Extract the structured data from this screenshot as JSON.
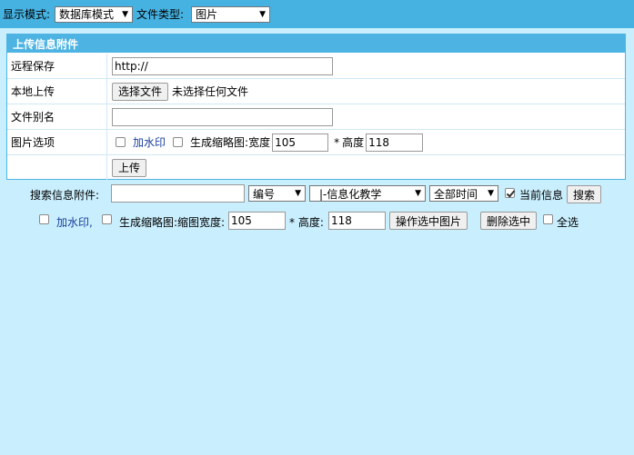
{
  "topbar": {
    "display_mode_label": "显示模式:",
    "display_mode_value": "数据库模式",
    "file_type_label": "文件类型:",
    "file_type_value": "图片"
  },
  "upload_panel": {
    "title": "上传信息附件",
    "remote_label": "远程保存",
    "remote_value": "http://",
    "local_label": "本地上传",
    "choose_file_button": "选择文件",
    "no_file_text": "未选择任何文件",
    "alias_label": "文件别名",
    "alias_value": "",
    "image_options_label": "图片选项",
    "watermark_label": "加水印",
    "thumbnail_label": "生成缩略图:",
    "width_label": "宽度",
    "width_value": "105",
    "times": "*",
    "height_label": "高度",
    "height_value": "118",
    "upload_button": "上传"
  },
  "search": {
    "label": "搜索信息附件:",
    "query_value": "",
    "field_value": "编号",
    "category_value": "|-信息化教学",
    "time_value": "全部时间",
    "current_info_label": "当前信息",
    "current_info_checked": true,
    "search_button": "搜索"
  },
  "batch": {
    "watermark_label": "加水印,",
    "thumbnail_label": "生成缩略图:缩图宽度:",
    "width_value": "105",
    "height_label": "* 高度:",
    "height_value": "118",
    "process_button": "操作选中图片",
    "delete_button": "删除选中",
    "select_all_label": "全选"
  }
}
